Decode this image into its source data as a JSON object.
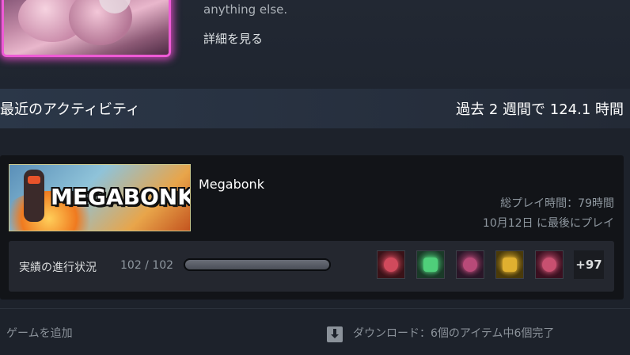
{
  "showcase": {
    "text": "anything else.",
    "details_link": "詳細を見る"
  },
  "activity": {
    "title": "最近のアクティビティ",
    "hours_summary": "過去 2 週間で 124.1 時間"
  },
  "game": {
    "name": "Megabonk",
    "capsule_title": "MEGABONK",
    "total_playtime": "総プレイ時間：79時間",
    "last_played": "10月12日 に最後にプレイ",
    "achievements": {
      "label": "実績の進行状況",
      "count": "102 / 102",
      "progress_fraction": 1.0,
      "more": "+97",
      "icons": [
        {
          "name": "heart-achievement-icon",
          "bg": "#3a1218",
          "accent": "#d14a5c"
        },
        {
          "name": "microphone-achievement-icon",
          "bg": "#1a3a28",
          "accent": "#4fcf7a"
        },
        {
          "name": "mask-achievement-icon",
          "bg": "#2a1628",
          "accent": "#b84a78"
        },
        {
          "name": "sword-achievement-icon",
          "bg": "#4a3a0a",
          "accent": "#e0b030"
        },
        {
          "name": "gloves-achievement-icon",
          "bg": "#3a1020",
          "accent": "#c85070"
        }
      ]
    }
  },
  "footer": {
    "add_game": "ゲームを追加",
    "download_status": "ダウンロード：6個のアイテム中6個完了"
  }
}
